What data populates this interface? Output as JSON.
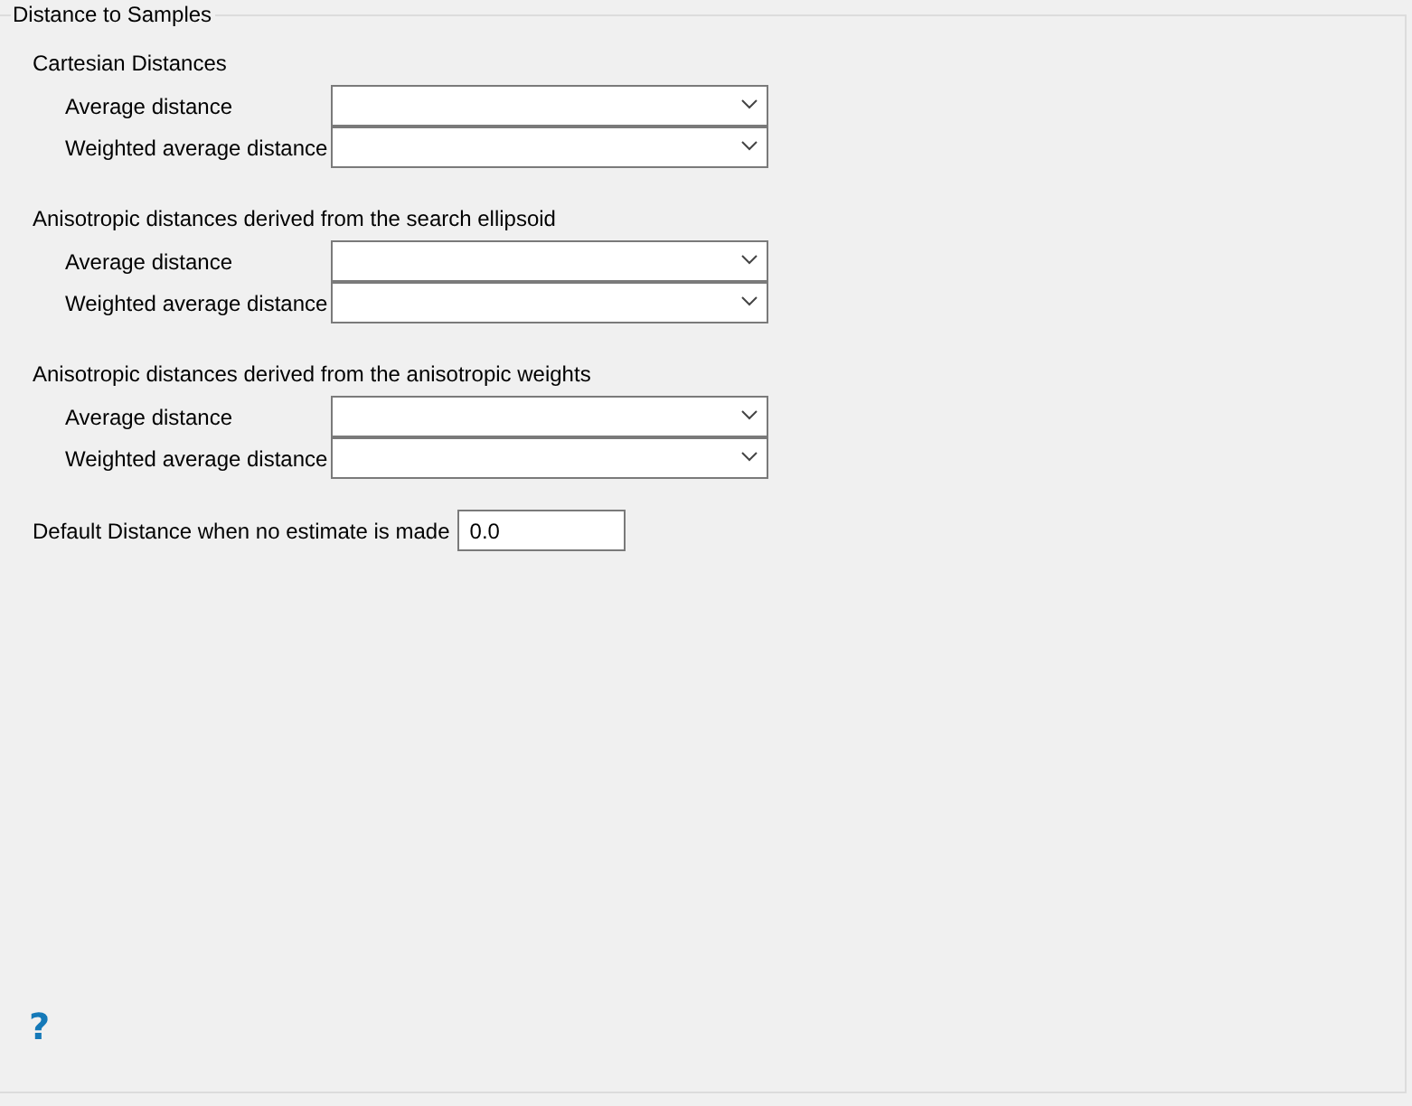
{
  "panel": {
    "title": "Distance to Samples"
  },
  "groups": [
    {
      "heading": "Cartesian Distances",
      "rows": [
        {
          "label": "Average distance"
        },
        {
          "label": "Weighted average distance"
        }
      ]
    },
    {
      "heading": "Anisotropic distances derived from the search ellipsoid",
      "rows": [
        {
          "label": "Average distance"
        },
        {
          "label": "Weighted average distance"
        }
      ]
    },
    {
      "heading": "Anisotropic distances derived from the anisotropic weights",
      "rows": [
        {
          "label": "Average distance"
        },
        {
          "label": "Weighted average distance"
        }
      ]
    }
  ],
  "default_distance": {
    "label": "Default Distance when no estimate is made",
    "value": "0.0"
  },
  "help": "?"
}
